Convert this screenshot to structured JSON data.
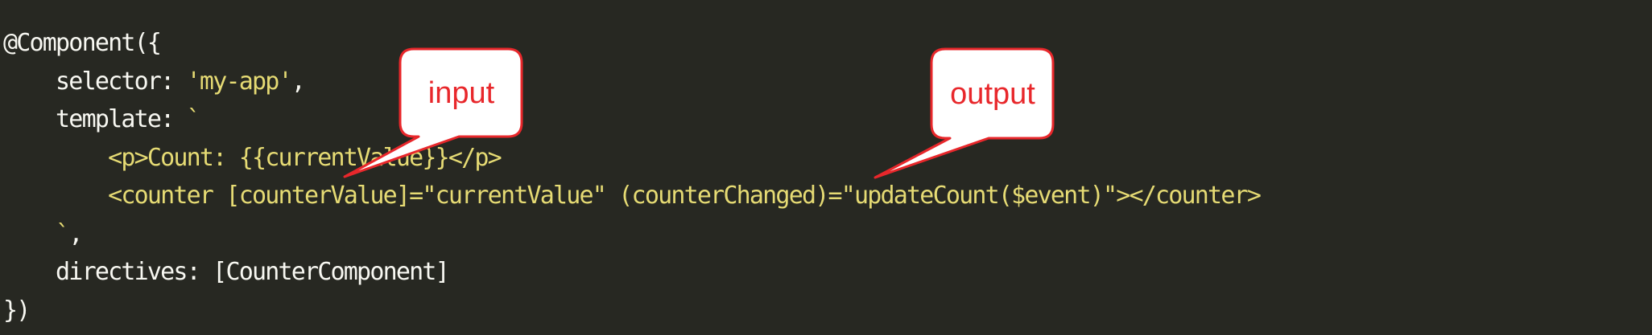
{
  "code": {
    "lines": [
      [
        {
          "t": "@Component({",
          "c": "w"
        }
      ],
      [
        {
          "t": "    selector: ",
          "c": "w"
        },
        {
          "t": "'my-app'",
          "c": "y"
        },
        {
          "t": ",",
          "c": "w"
        }
      ],
      [
        {
          "t": "    template: ",
          "c": "w"
        },
        {
          "t": "`",
          "c": "y"
        }
      ],
      [
        {
          "t": "        <p>Count: {{currentValue}}</p>",
          "c": "y"
        }
      ],
      [
        {
          "t": "        <counter [counterValue]=\"currentValue\" (counterChanged)=\"updateCount($event)\"></counter>",
          "c": "y"
        }
      ],
      [
        {
          "t": "    `",
          "c": "y"
        },
        {
          "t": ",",
          "c": "w"
        }
      ],
      [
        {
          "t": "    directives: [CounterComponent]",
          "c": "w"
        }
      ],
      [
        {
          "t": "})",
          "c": "w"
        }
      ]
    ]
  },
  "callouts": {
    "input": {
      "label": "input"
    },
    "output": {
      "label": "output"
    }
  },
  "colors": {
    "background": "#272822",
    "code_default": "#f8f8f2",
    "code_string": "#e6db74",
    "callout_accent": "#e8272b"
  }
}
